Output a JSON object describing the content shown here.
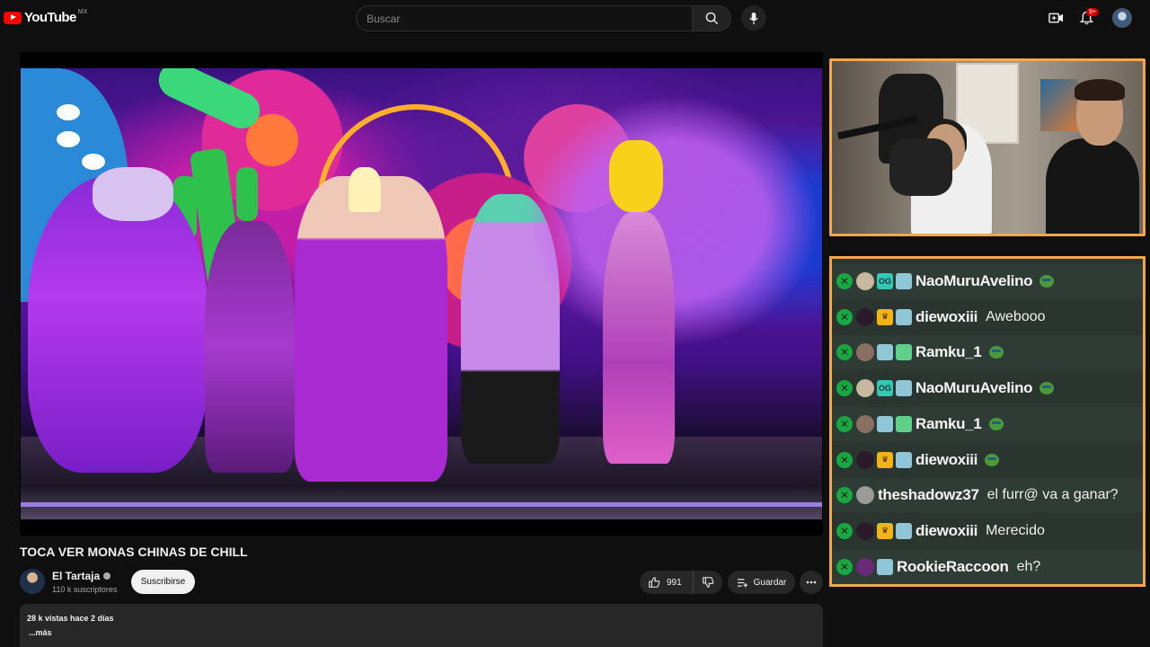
{
  "header": {
    "logo_text": "YouTube",
    "country_code": "MX",
    "search_placeholder": "Buscar",
    "notifications_badge": "9+"
  },
  "video": {
    "title": "TOCA VER MONAS CHINAS DE CHILL",
    "channel_name": "El Tartaja",
    "subscribers": "110 k suscriptores",
    "subscribe_label": "Suscribirse",
    "likes": "991",
    "save_label": "Guardar"
  },
  "description": {
    "stats": "28 k vistas  hace 2 días",
    "more": "...más"
  },
  "chat": {
    "messages": [
      {
        "user": "NaoMuruAvelino",
        "text": "",
        "avatar_color": "#c8b8a0",
        "badges": [
          "og",
          "cat"
        ],
        "emote": true
      },
      {
        "user": "diewoxiii",
        "text": "Awebooo",
        "avatar_color": "#2a1a2a",
        "badges": [
          "crown",
          "cat"
        ],
        "emote": false
      },
      {
        "user": "Ramku_1",
        "text": "",
        "avatar_color": "#8a7060",
        "badges": [
          "cat",
          "green"
        ],
        "emote": true
      },
      {
        "user": "NaoMuruAvelino",
        "text": "",
        "avatar_color": "#c8b8a0",
        "badges": [
          "og",
          "cat"
        ],
        "emote": true
      },
      {
        "user": "Ramku_1",
        "text": "",
        "avatar_color": "#8a7060",
        "badges": [
          "cat",
          "green"
        ],
        "emote": true
      },
      {
        "user": "diewoxiii",
        "text": "",
        "avatar_color": "#2a1a2a",
        "badges": [
          "crown",
          "cat"
        ],
        "emote": true
      },
      {
        "user": "theshadowz37",
        "text": "el furr@ va a ganar?",
        "avatar_color": "#9a9a9a",
        "badges": [],
        "emote": false
      },
      {
        "user": "diewoxiii",
        "text": "Merecido",
        "avatar_color": "#2a1a2a",
        "badges": [
          "crown",
          "cat"
        ],
        "emote": false
      },
      {
        "user": "RookieRaccoon",
        "text": "eh?",
        "avatar_color": "#6a2a7a",
        "badges": [
          "cat"
        ],
        "emote": false
      }
    ]
  }
}
